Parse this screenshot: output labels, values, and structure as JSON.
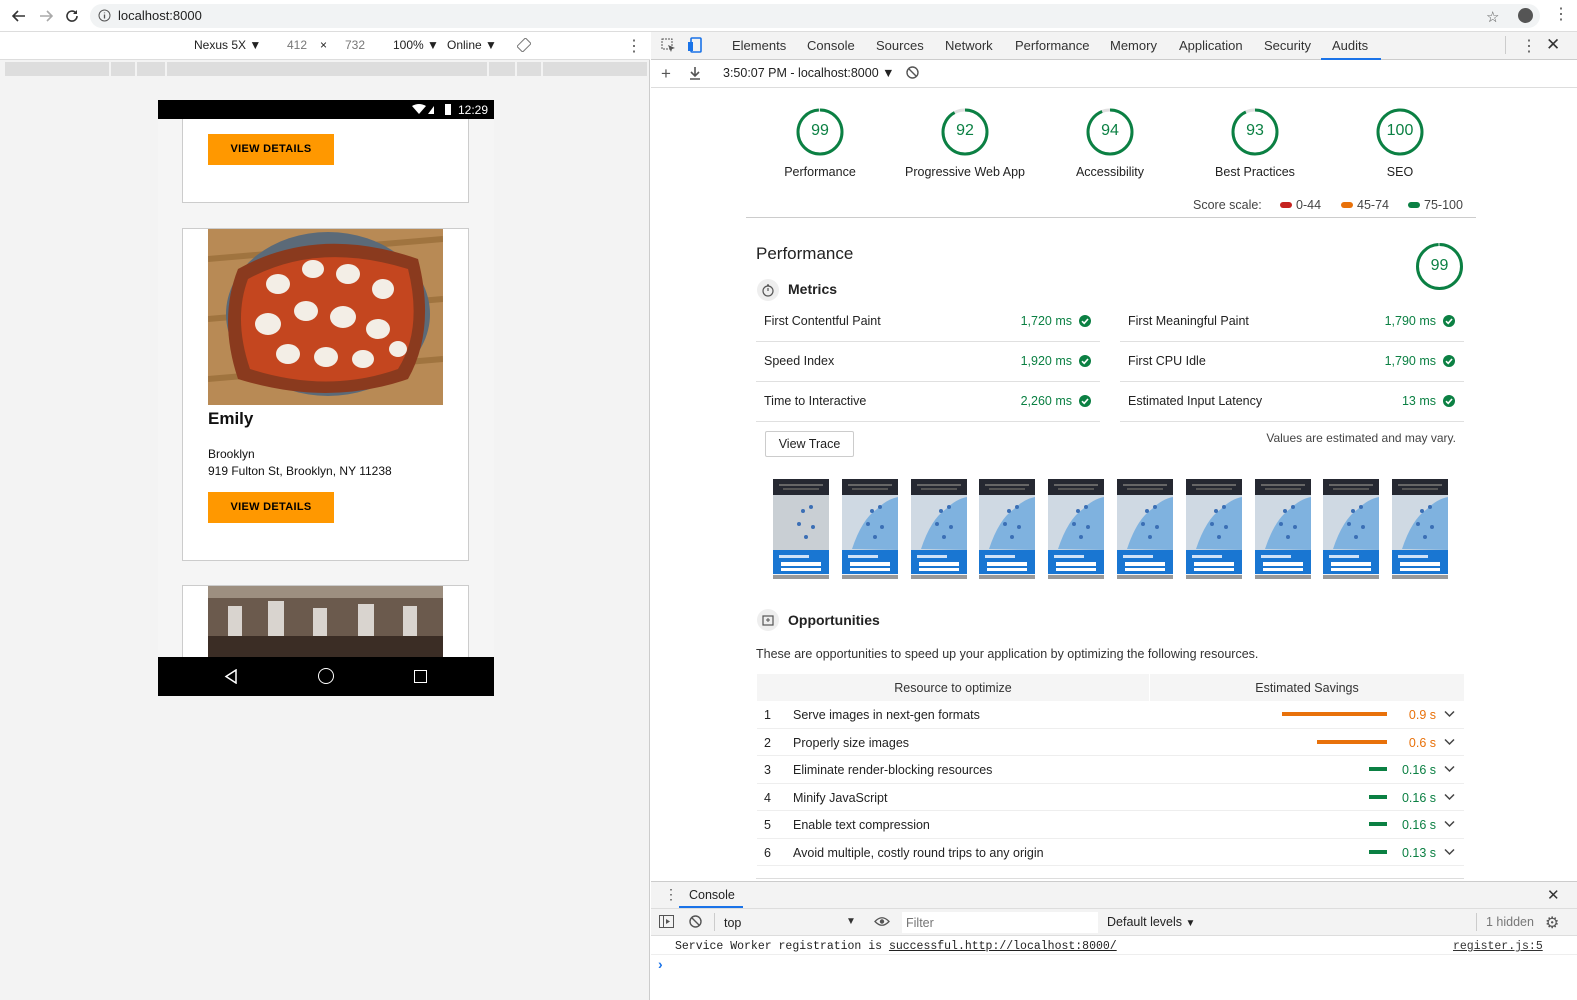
{
  "browser": {
    "url": "localhost:8000"
  },
  "device_toolbar": {
    "device": "Nexus 5X",
    "width": "412",
    "height": "732",
    "times": "×",
    "zoom": "100%",
    "network": "Online"
  },
  "phone": {
    "time": "12:29",
    "cards": [
      {
        "button": "VIEW DETAILS"
      },
      {
        "name": "Emily",
        "neighborhood": "Brooklyn",
        "address": "919 Fulton St, Brooklyn, NY 11238",
        "button": "VIEW DETAILS"
      }
    ]
  },
  "devtools": {
    "tabs": [
      "Elements",
      "Console",
      "Sources",
      "Network",
      "Performance",
      "Memory",
      "Application",
      "Security",
      "Audits"
    ],
    "active_tab": "Audits",
    "audit_session": "3:50:07 PM - localhost:8000"
  },
  "gauges": [
    {
      "score": "99",
      "label": "Performance"
    },
    {
      "score": "92",
      "label": "Progressive Web App"
    },
    {
      "score": "94",
      "label": "Accessibility"
    },
    {
      "score": "93",
      "label": "Best Practices"
    },
    {
      "score": "100",
      "label": "SEO"
    }
  ],
  "score_scale": {
    "label": "Score scale:",
    "ranges": [
      "0-44",
      "45-74",
      "75-100"
    ],
    "colors": [
      "#c5221f",
      "#e8710a",
      "#0b8043"
    ]
  },
  "performance": {
    "title": "Performance",
    "score": "99",
    "metrics_title": "Metrics",
    "metrics": [
      {
        "name": "First Contentful Paint",
        "value": "1,720 ms"
      },
      {
        "name": "First Meaningful Paint",
        "value": "1,790 ms"
      },
      {
        "name": "Speed Index",
        "value": "1,920 ms"
      },
      {
        "name": "First CPU Idle",
        "value": "1,790 ms"
      },
      {
        "name": "Time to Interactive",
        "value": "2,260 ms"
      },
      {
        "name": "Estimated Input Latency",
        "value": "13 ms"
      }
    ],
    "view_trace": "View Trace",
    "estimate_note": "Values are estimated and may vary.",
    "opportunities_title": "Opportunities",
    "opportunities_desc": "These are opportunities to speed up your application by optimizing the following resources.",
    "col_resource": "Resource to optimize",
    "col_savings": "Estimated Savings",
    "opportunities": [
      {
        "n": "1",
        "name": "Serve images in next-gen formats",
        "savings": "0.9 s",
        "severity": "average",
        "bar": 0.9
      },
      {
        "n": "2",
        "name": "Properly size images",
        "savings": "0.6 s",
        "severity": "average",
        "bar": 0.6
      },
      {
        "n": "3",
        "name": "Eliminate render-blocking resources",
        "savings": "0.16 s",
        "severity": "pass",
        "bar": 0.16
      },
      {
        "n": "4",
        "name": "Minify JavaScript",
        "savings": "0.16 s",
        "severity": "pass",
        "bar": 0.16
      },
      {
        "n": "5",
        "name": "Enable text compression",
        "savings": "0.16 s",
        "severity": "pass",
        "bar": 0.16
      },
      {
        "n": "6",
        "name": "Avoid multiple, costly round trips to any origin",
        "savings": "0.13 s",
        "severity": "pass",
        "bar": 0.13
      }
    ]
  },
  "console": {
    "tab": "Console",
    "context": "top",
    "filter_placeholder": "Filter",
    "levels": "Default levels",
    "hidden": "1 hidden",
    "message_prefix": "Service Worker registration is ",
    "message_link": "successful.http://localhost:8000/",
    "source": "register.js:5",
    "prompt": "›"
  }
}
